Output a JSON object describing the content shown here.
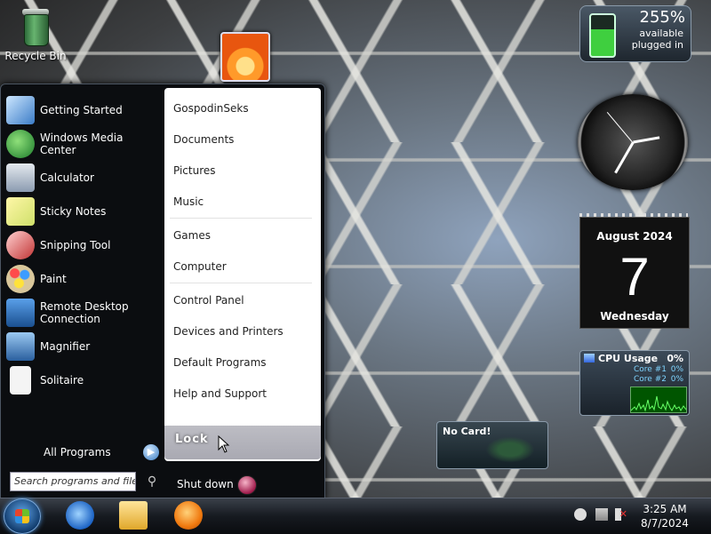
{
  "desktop": {
    "recycle_bin_label": "Recycle Bin"
  },
  "start_menu": {
    "programs": [
      {
        "label": "Getting Started",
        "icon": "getting-started-icon"
      },
      {
        "label": "Windows Media Center",
        "icon": "media-center-icon"
      },
      {
        "label": "Calculator",
        "icon": "calculator-icon"
      },
      {
        "label": "Sticky Notes",
        "icon": "sticky-notes-icon"
      },
      {
        "label": "Snipping Tool",
        "icon": "snipping-tool-icon"
      },
      {
        "label": "Paint",
        "icon": "paint-icon"
      },
      {
        "label": "Remote Desktop Connection",
        "icon": "remote-desktop-icon"
      },
      {
        "label": "Magnifier",
        "icon": "magnifier-icon"
      },
      {
        "label": "Solitaire",
        "icon": "solitaire-icon"
      }
    ],
    "all_programs_label": "All Programs",
    "search_placeholder": "Search programs and files",
    "right_items": {
      "user": "GospodinSeks",
      "documents": "Documents",
      "pictures": "Pictures",
      "music": "Music",
      "games": "Games",
      "computer": "Computer",
      "control_panel": "Control Panel",
      "devices_printers": "Devices and Printers",
      "default_programs": "Default Programs",
      "help_support": "Help and Support"
    },
    "lock_label": "Lock",
    "shutdown_label": "Shut down"
  },
  "gadgets": {
    "battery": {
      "percent": "255%",
      "line1": "available",
      "line2": "plugged in"
    },
    "calendar": {
      "month": "August 2024",
      "day": "7",
      "weekday": "Wednesday"
    },
    "cpu": {
      "title": "CPU Usage",
      "total": "0%",
      "core1_label": "Core #1",
      "core1": "0%",
      "core2_label": "Core #2",
      "core2": "0%"
    },
    "nvidia": {
      "text": "No Card!"
    }
  },
  "taskbar": {
    "apps": [
      "internet-explorer-icon",
      "windows-explorer-icon",
      "media-player-icon"
    ],
    "clock_time": "3:25 AM",
    "clock_date": "8/7/2024"
  },
  "colors": {
    "start_menu_bg": "#0b0d10",
    "right_pane_bg": "#ffffff",
    "taskbar": "#161a20"
  }
}
